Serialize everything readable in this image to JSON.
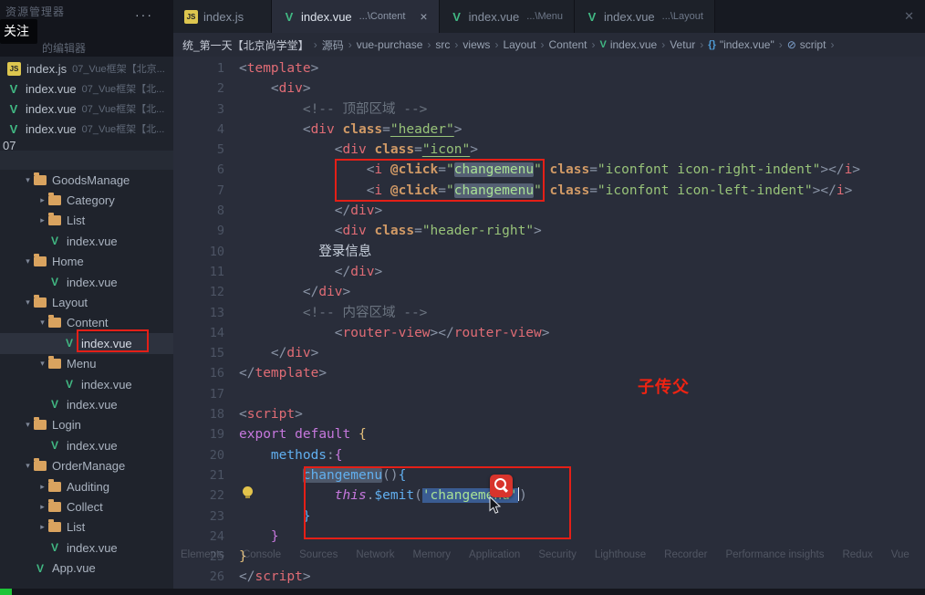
{
  "corner": {
    "panel_title": "资源管理器",
    "more": "···",
    "follow_badge": "关注",
    "open_editors_label": "的编辑器"
  },
  "window": {
    "close_icon": "✕"
  },
  "tabs": [
    {
      "icon": "js",
      "label": "index.js",
      "detail": "",
      "active": false,
      "close": false
    },
    {
      "icon": "vue",
      "label": "index.vue",
      "detail": "...\\Content",
      "active": true,
      "close": true
    },
    {
      "icon": "vue",
      "label": "index.vue",
      "detail": "...\\Menu",
      "active": false,
      "close": false
    },
    {
      "icon": "vue",
      "label": "index.vue",
      "detail": "...\\Layout",
      "active": false,
      "close": false
    }
  ],
  "breadcrumb": {
    "separator": "›",
    "items": [
      {
        "label": "统_第一天【北京尚学堂】",
        "icon": "",
        "first": true
      },
      {
        "label": "源码",
        "icon": ""
      },
      {
        "label": "vue-purchase",
        "icon": ""
      },
      {
        "label": "src",
        "icon": ""
      },
      {
        "label": "views",
        "icon": ""
      },
      {
        "label": "Layout",
        "icon": ""
      },
      {
        "label": "Content",
        "icon": ""
      },
      {
        "label": "index.vue",
        "icon": "vue"
      },
      {
        "label": "Vetur",
        "icon": ""
      },
      {
        "label": "\"index.vue\"",
        "icon": "braces"
      },
      {
        "label": "script",
        "icon": "symbol"
      }
    ]
  },
  "sidebar": {
    "open_editors": [
      {
        "icon": "js",
        "name": "index.js",
        "detail": "07_Vue框架【北京..."
      },
      {
        "icon": "vue",
        "name": "index.vue",
        "detail": "07_Vue框架【北..."
      },
      {
        "icon": "vue",
        "name": "index.vue",
        "detail": "07_Vue框架【北..."
      },
      {
        "icon": "vue",
        "name": "index.vue",
        "detail": "07_Vue框架【北..."
      }
    ],
    "partial_label": "07",
    "tree": [
      {
        "depth": 1,
        "type": "folder",
        "expanded": true,
        "name": "GoodsManage"
      },
      {
        "depth": 2,
        "type": "folder",
        "expanded": false,
        "name": "Category"
      },
      {
        "depth": 2,
        "type": "folder",
        "expanded": false,
        "name": "List"
      },
      {
        "depth": 2,
        "type": "vue",
        "name": "index.vue"
      },
      {
        "depth": 1,
        "type": "folder",
        "expanded": true,
        "name": "Home"
      },
      {
        "depth": 2,
        "type": "vue",
        "name": "index.vue"
      },
      {
        "depth": 1,
        "type": "folder",
        "expanded": true,
        "name": "Layout"
      },
      {
        "depth": 2,
        "type": "folder",
        "expanded": true,
        "name": "Content"
      },
      {
        "depth": 3,
        "type": "vue",
        "name": "index.vue",
        "selected": true
      },
      {
        "depth": 2,
        "type": "folder",
        "expanded": true,
        "name": "Menu"
      },
      {
        "depth": 3,
        "type": "vue",
        "name": "index.vue"
      },
      {
        "depth": 2,
        "type": "vue",
        "name": "index.vue"
      },
      {
        "depth": 1,
        "type": "folder",
        "expanded": true,
        "name": "Login"
      },
      {
        "depth": 2,
        "type": "vue",
        "name": "index.vue"
      },
      {
        "depth": 1,
        "type": "folder",
        "expanded": true,
        "name": "OrderManage"
      },
      {
        "depth": 2,
        "type": "folder",
        "expanded": false,
        "name": "Auditing"
      },
      {
        "depth": 2,
        "type": "folder",
        "expanded": false,
        "name": "Collect"
      },
      {
        "depth": 2,
        "type": "folder",
        "expanded": false,
        "name": "List"
      },
      {
        "depth": 2,
        "type": "vue",
        "name": "index.vue"
      },
      {
        "depth": 1,
        "type": "vue",
        "name": "App.vue"
      }
    ]
  },
  "editor": {
    "lines": [
      {
        "n": 1,
        "i": 0,
        "tk": [
          [
            "p",
            "<"
          ],
          [
            "t",
            "template"
          ],
          [
            "p",
            ">"
          ]
        ]
      },
      {
        "n": 2,
        "i": 4,
        "tk": [
          [
            "p",
            "<"
          ],
          [
            "t",
            "div"
          ],
          [
            "p",
            ">"
          ]
        ]
      },
      {
        "n": 3,
        "i": 8,
        "tk": [
          [
            "c",
            "<!-- 顶部区域 -->"
          ]
        ]
      },
      {
        "n": 4,
        "i": 8,
        "tk": [
          [
            "p",
            "<"
          ],
          [
            "t",
            "div"
          ],
          [
            "w",
            " "
          ],
          [
            "a",
            "class"
          ],
          [
            "p",
            "="
          ],
          [
            "su",
            "\"header\""
          ],
          [
            "p",
            ">"
          ]
        ]
      },
      {
        "n": 5,
        "i": 12,
        "tk": [
          [
            "p",
            "<"
          ],
          [
            "t",
            "div"
          ],
          [
            "w",
            " "
          ],
          [
            "a",
            "class"
          ],
          [
            "p",
            "="
          ],
          [
            "su",
            "\"icon\""
          ],
          [
            "p",
            ">"
          ]
        ]
      },
      {
        "n": 6,
        "i": 16,
        "tk": [
          [
            "p",
            "<"
          ],
          [
            "t",
            "i"
          ],
          [
            "w",
            " "
          ],
          [
            "a",
            "@click"
          ],
          [
            "p",
            "="
          ],
          [
            "s",
            "\""
          ],
          [
            "sh",
            "changemenu"
          ],
          [
            "s",
            "\""
          ],
          [
            "w",
            " "
          ],
          [
            "a",
            "class"
          ],
          [
            "p",
            "="
          ],
          [
            "s",
            "\"iconfont icon-right-indent\""
          ],
          [
            "p",
            "></"
          ],
          [
            "t",
            "i"
          ],
          [
            "p",
            ">"
          ]
        ]
      },
      {
        "n": 7,
        "i": 16,
        "tk": [
          [
            "p",
            "<"
          ],
          [
            "t",
            "i"
          ],
          [
            "w",
            " "
          ],
          [
            "a",
            "@click"
          ],
          [
            "p",
            "="
          ],
          [
            "s",
            "\""
          ],
          [
            "sh",
            "changemenu"
          ],
          [
            "s",
            "\""
          ],
          [
            "w",
            " "
          ],
          [
            "a",
            "class"
          ],
          [
            "p",
            "="
          ],
          [
            "s",
            "\"iconfont icon-left-indent\""
          ],
          [
            "p",
            "></"
          ],
          [
            "t",
            "i"
          ],
          [
            "p",
            ">"
          ]
        ]
      },
      {
        "n": 8,
        "i": 12,
        "tk": [
          [
            "p",
            "</"
          ],
          [
            "t",
            "div"
          ],
          [
            "p",
            ">"
          ]
        ]
      },
      {
        "n": 9,
        "i": 12,
        "tk": [
          [
            "p",
            "<"
          ],
          [
            "t",
            "div"
          ],
          [
            "w",
            " "
          ],
          [
            "a",
            "class"
          ],
          [
            "p",
            "="
          ],
          [
            "s",
            "\"header-right\""
          ],
          [
            "p",
            ">"
          ]
        ]
      },
      {
        "n": 10,
        "i": 10,
        "tk": [
          [
            "w",
            "登录信息"
          ]
        ]
      },
      {
        "n": 11,
        "i": 12,
        "tk": [
          [
            "p",
            "</"
          ],
          [
            "t",
            "div"
          ],
          [
            "p",
            ">"
          ]
        ]
      },
      {
        "n": 12,
        "i": 8,
        "tk": [
          [
            "p",
            "</"
          ],
          [
            "t",
            "div"
          ],
          [
            "p",
            ">"
          ]
        ]
      },
      {
        "n": 13,
        "i": 8,
        "tk": [
          [
            "c",
            "<!-- 内容区域 -->"
          ]
        ]
      },
      {
        "n": 14,
        "i": 12,
        "tk": [
          [
            "p",
            "<"
          ],
          [
            "t",
            "router-view"
          ],
          [
            "p",
            "></"
          ],
          [
            "t",
            "router-view"
          ],
          [
            "p",
            ">"
          ]
        ]
      },
      {
        "n": 15,
        "i": 4,
        "tk": [
          [
            "p",
            "</"
          ],
          [
            "t",
            "div"
          ],
          [
            "p",
            ">"
          ]
        ]
      },
      {
        "n": 16,
        "i": 0,
        "tk": [
          [
            "p",
            "</"
          ],
          [
            "t",
            "template"
          ],
          [
            "p",
            ">"
          ]
        ]
      },
      {
        "n": 17,
        "i": 0,
        "tk": []
      },
      {
        "n": 18,
        "i": 0,
        "tk": [
          [
            "p",
            "<"
          ],
          [
            "t",
            "script"
          ],
          [
            "p",
            ">"
          ]
        ]
      },
      {
        "n": 19,
        "i": 0,
        "tk": [
          [
            "k",
            "export"
          ],
          [
            "w",
            " "
          ],
          [
            "k",
            "default"
          ],
          [
            "w",
            " "
          ],
          [
            "b1",
            "{"
          ]
        ]
      },
      {
        "n": 20,
        "i": 4,
        "tk": [
          [
            "f",
            "methods"
          ],
          [
            "p",
            ":"
          ],
          [
            "b2",
            "{"
          ]
        ]
      },
      {
        "n": 21,
        "i": 8,
        "tk": [
          [
            "fh",
            "changemenu"
          ],
          [
            "p",
            "()"
          ],
          [
            "b3",
            "{"
          ]
        ]
      },
      {
        "n": 22,
        "i": 12,
        "tk": [
          [
            "ki",
            "this"
          ],
          [
            "p",
            "."
          ],
          [
            "f",
            "$emit"
          ],
          [
            "p",
            "("
          ],
          [
            "ss",
            "'changemenu'"
          ],
          [
            "caret",
            ""
          ],
          [
            "p",
            ")"
          ]
        ]
      },
      {
        "n": 23,
        "i": 8,
        "tk": [
          [
            "b3",
            "}"
          ]
        ]
      },
      {
        "n": 24,
        "i": 4,
        "tk": [
          [
            "b2",
            "}"
          ]
        ]
      },
      {
        "n": 25,
        "i": 0,
        "tk": [
          [
            "b1",
            "}"
          ]
        ]
      },
      {
        "n": 26,
        "i": 0,
        "tk": [
          [
            "p",
            "</"
          ],
          [
            "t",
            "script"
          ],
          [
            "p",
            ">"
          ]
        ]
      }
    ]
  },
  "annotations": {
    "child_to_parent": "子传父"
  },
  "devtools": {
    "tabs": [
      "Elements",
      "Console",
      "Sources",
      "Network",
      "Memory",
      "Application",
      "Security",
      "Lighthouse",
      "Recorder",
      "Performance insights",
      "Redux",
      "Vue"
    ]
  },
  "colors": {
    "annotation_red": "#e41f17",
    "selection_blue": "#3a5c92",
    "vue_green": "#41b883",
    "folder_orange": "#d9a35f",
    "status_green": "#1ec437"
  }
}
